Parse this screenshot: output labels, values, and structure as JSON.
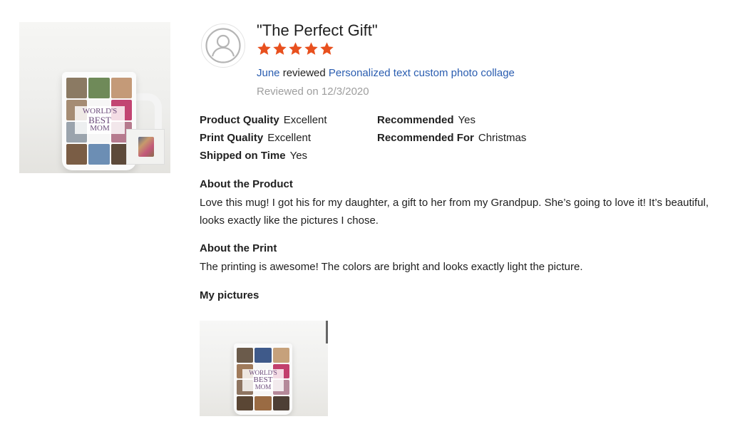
{
  "review": {
    "title": "\"The Perfect Gift\"",
    "rating": 5,
    "max_rating": 5,
    "reviewer": "June",
    "reviewed_word": "reviewed",
    "product_link": "Personalized text custom photo collage",
    "date": "Reviewed on 12/3/2020"
  },
  "product_image": {
    "mug_text": [
      "WORLD'S",
      "BEST",
      "MOM"
    ]
  },
  "attributes": {
    "left": [
      {
        "label": "Product Quality",
        "value": "Excellent"
      },
      {
        "label": "Print Quality",
        "value": "Excellent"
      },
      {
        "label": "Shipped on Time",
        "value": "Yes"
      }
    ],
    "right": [
      {
        "label": "Recommended",
        "value": "Yes"
      },
      {
        "label": "Recommended For",
        "value": "Christmas"
      }
    ]
  },
  "about_product": {
    "heading": "About the Product",
    "text": "Love this mug! I got his for my daughter, a gift to her from my Grandpup. She’s going to love it! It’s beautiful, looks exactly like the pictures I chose."
  },
  "about_print": {
    "heading": "About the Print",
    "text": "The printing is awesome! The colors are bright and looks exactly light the picture."
  },
  "my_pictures": {
    "heading": "My pictures"
  },
  "colors": {
    "star": "#e8501e",
    "link": "#2a5db0",
    "muted": "#9e9e9e",
    "text": "#212121"
  }
}
